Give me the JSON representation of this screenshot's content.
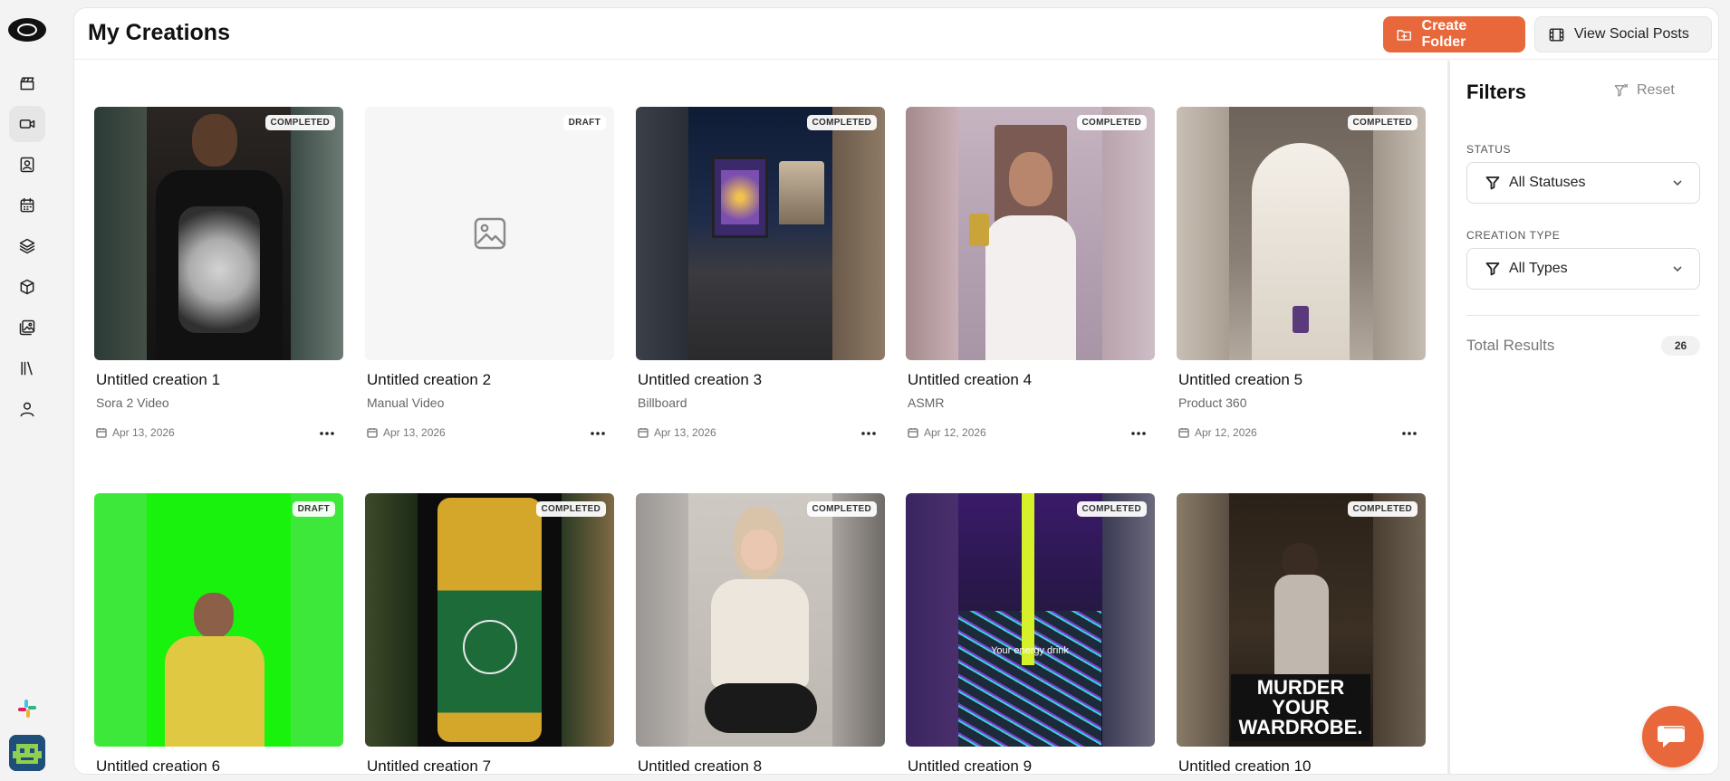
{
  "page": {
    "title": "My Creations",
    "create_folder_label": "Create Folder",
    "view_social_label": "View Social Posts"
  },
  "sidebar": {
    "items": [
      {
        "name": "clapperboard-icon"
      },
      {
        "name": "video-icon",
        "active": true
      },
      {
        "name": "contact-card-icon"
      },
      {
        "name": "calendar-icon"
      },
      {
        "name": "layers-icon"
      },
      {
        "name": "package-icon"
      },
      {
        "name": "image-gallery-icon"
      },
      {
        "name": "library-icon"
      },
      {
        "name": "user-icon"
      }
    ]
  },
  "creations": [
    {
      "title": "Untitled creation 1",
      "type": "Sora 2 Video",
      "date": "Apr 13, 2026",
      "status": "COMPLETED"
    },
    {
      "title": "Untitled creation 2",
      "type": "Manual Video",
      "date": "Apr 13, 2026",
      "status": "DRAFT"
    },
    {
      "title": "Untitled creation 3",
      "type": "Billboard",
      "date": "Apr 13, 2026",
      "status": "COMPLETED"
    },
    {
      "title": "Untitled creation 4",
      "type": "ASMR",
      "date": "Apr 12, 2026",
      "status": "COMPLETED"
    },
    {
      "title": "Untitled creation 5",
      "type": "Product 360",
      "date": "Apr 12, 2026",
      "status": "COMPLETED"
    },
    {
      "title": "Untitled creation 6",
      "status": "DRAFT"
    },
    {
      "title": "Untitled creation 7",
      "status": "COMPLETED"
    },
    {
      "title": "Untitled creation 8",
      "status": "COMPLETED"
    },
    {
      "title": "Untitled creation 9",
      "status": "COMPLETED",
      "overlay_text": "Your energy drink"
    },
    {
      "title": "Untitled creation 10",
      "status": "COMPLETED",
      "overlay_text": "MURDER YOUR WARDROBE."
    }
  ],
  "filters": {
    "title": "Filters",
    "reset_label": "Reset",
    "status_label": "STATUS",
    "status_value": "All Statuses",
    "type_label": "CREATION TYPE",
    "type_value": "All Types",
    "total_label": "Total Results",
    "total_count": "26"
  },
  "colors": {
    "accent": "#e9683b",
    "background": "#f3f3f3",
    "panel": "#ffffff"
  }
}
